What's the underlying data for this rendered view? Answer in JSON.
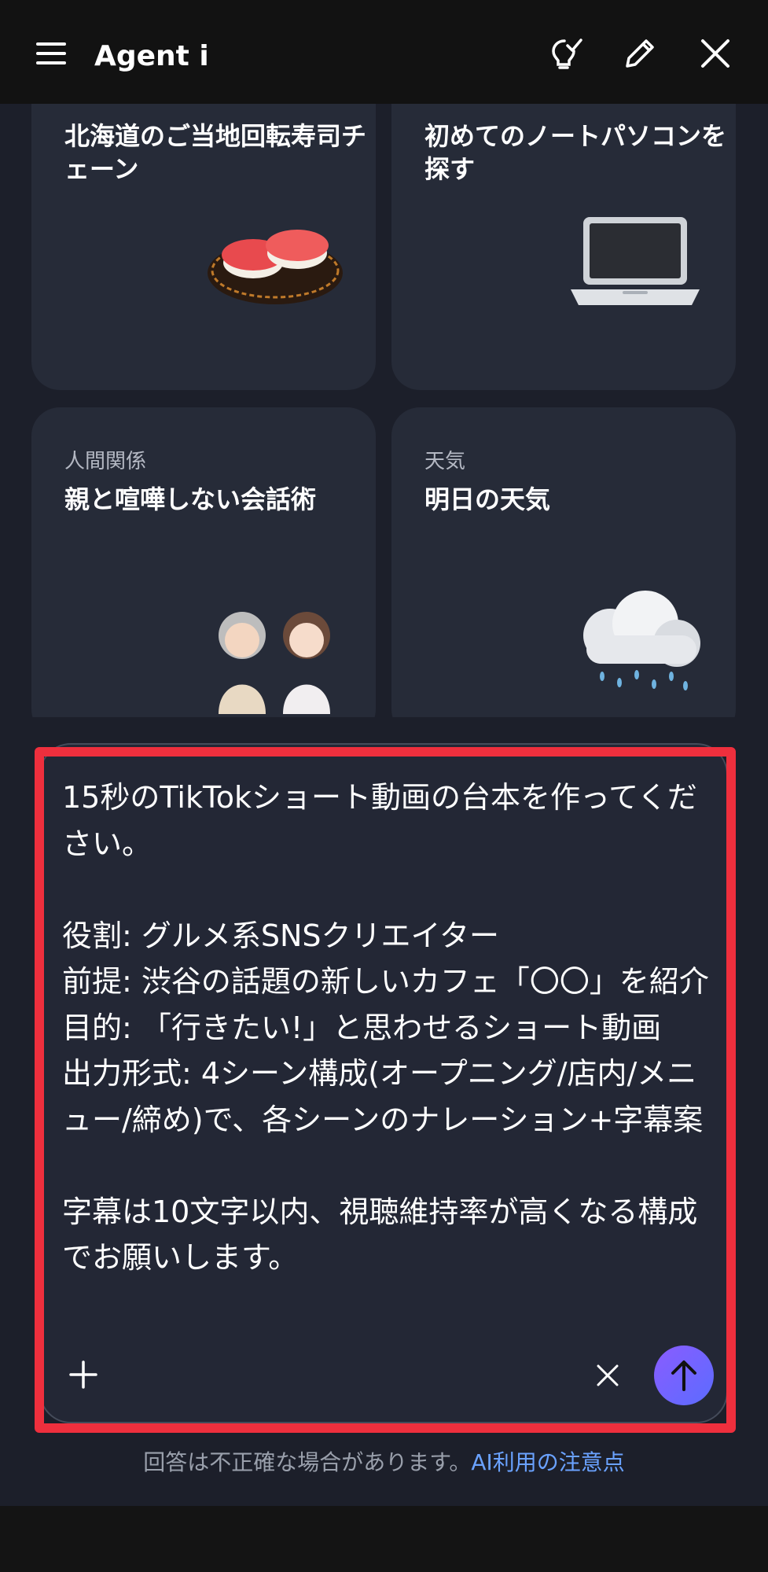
{
  "header": {
    "title": "Agent i",
    "icons": [
      "menu-icon",
      "lightbulb-check-icon",
      "pencil-icon",
      "close-icon"
    ]
  },
  "cards": [
    {
      "category": "",
      "title": "北海道のご当地回転寿司チェーン",
      "image": "sushi-illustration"
    },
    {
      "category": "",
      "title": "初めてのノートパソコンを探す",
      "image": "laptop-illustration"
    },
    {
      "category": "人間関係",
      "title": "親と喧嘩しない会話術",
      "image": "parent-child-illustration"
    },
    {
      "category": "天気",
      "title": "明日の天気",
      "image": "rain-cloud-illustration"
    }
  ],
  "composer": {
    "text": "15秒のTikTokショート動画の台本を作ってください。\n\n役割: グルメ系SNSクリエイター\n前提: 渋谷の話題の新しいカフェ「〇〇」を紹介\n目的: 「行きたい!」と思わせるショート動画\n出力形式: 4シーン構成(オープニング/店内/メニュー/締め)で、各シーンのナレーション+字幕案\n\n字幕は10文字以内、視聴維持率が高くなる構成でお願いします。",
    "icons": [
      "plus-icon",
      "clear-icon",
      "send-arrow-icon"
    ]
  },
  "footer": {
    "note": "回答は不正確な場合があります。",
    "link": "AI利用の注意点"
  },
  "colors": {
    "background": "#1c1f2a",
    "card": "#262b38",
    "highlight": "#ee2f3d",
    "send_button": "#7a5cff",
    "link": "#6aa2ff"
  }
}
